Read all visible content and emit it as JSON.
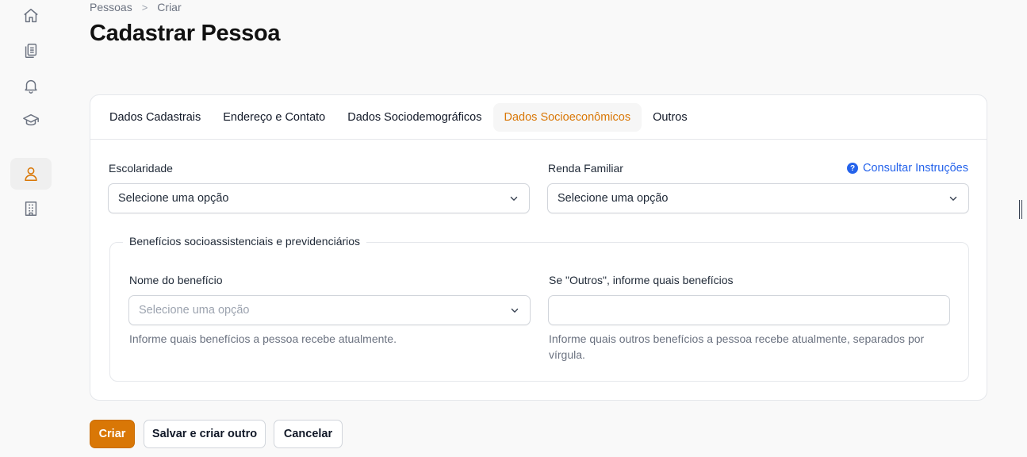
{
  "sidebar": {
    "items": [
      {
        "icon": "home-icon"
      },
      {
        "icon": "clipboard-icon"
      },
      {
        "icon": "bell-icon"
      },
      {
        "icon": "graduation-cap-icon"
      },
      {
        "icon": "user-icon",
        "active": true
      },
      {
        "icon": "building-icon"
      }
    ]
  },
  "breadcrumb": {
    "items": [
      "Pessoas",
      "Criar"
    ],
    "separator": ">"
  },
  "page": {
    "title": "Cadastrar Pessoa"
  },
  "tabs": [
    {
      "label": "Dados Cadastrais",
      "active": false
    },
    {
      "label": "Endereço e Contato",
      "active": false
    },
    {
      "label": "Dados Sociodemográficos",
      "active": false
    },
    {
      "label": "Dados Socioeconômicos",
      "active": true
    },
    {
      "label": "Outros",
      "active": false
    }
  ],
  "form": {
    "escolaridade": {
      "label": "Escolaridade",
      "value": "Selecione uma opção"
    },
    "renda_familiar": {
      "label": "Renda Familiar",
      "value": "Selecione uma opção"
    },
    "instructions_link": "Consultar Instruções",
    "beneficios": {
      "legend": "Benefícios socioassistenciais e previdenciários",
      "nome": {
        "label": "Nome do benefício",
        "placeholder": "Selecione uma opção",
        "help": "Informe quais benefícios a pessoa recebe atualmente."
      },
      "outros": {
        "label": "Se \"Outros\", informe quais benefícios",
        "value": "",
        "help": "Informe quais outros benefícios a pessoa recebe atualmente, separados por vírgula."
      }
    }
  },
  "actions": {
    "create": "Criar",
    "save_and_create_another": "Salvar e criar outro",
    "cancel": "Cancelar"
  },
  "colors": {
    "accent": "#d97706",
    "link": "#2563eb"
  }
}
